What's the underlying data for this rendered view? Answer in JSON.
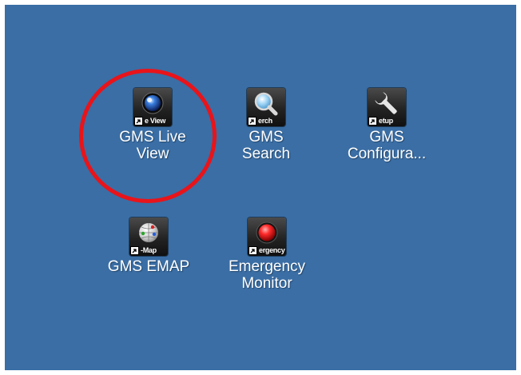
{
  "shortcuts": [
    {
      "label_lines": [
        "GMS Live",
        "View"
      ],
      "tile_caption": "e View",
      "icon": "globe-eye-icon"
    },
    {
      "label_lines": [
        "GMS",
        "Search"
      ],
      "tile_caption": "erch",
      "icon": "magnifier-icon"
    },
    {
      "label_lines": [
        "GMS",
        "Configura..."
      ],
      "tile_caption": "etup",
      "icon": "wrench-icon"
    },
    {
      "label_lines": [
        "GMS EMAP"
      ],
      "tile_caption": "-Map",
      "icon": "globe-map-icon"
    },
    {
      "label_lines": [
        "Emergency",
        "Monitor"
      ],
      "tile_caption": "ergency",
      "icon": "red-alarm-button-icon"
    }
  ],
  "colors": {
    "desktop": "#3a6ea5",
    "highlight": "#e8141a",
    "label": "#ffffff"
  }
}
